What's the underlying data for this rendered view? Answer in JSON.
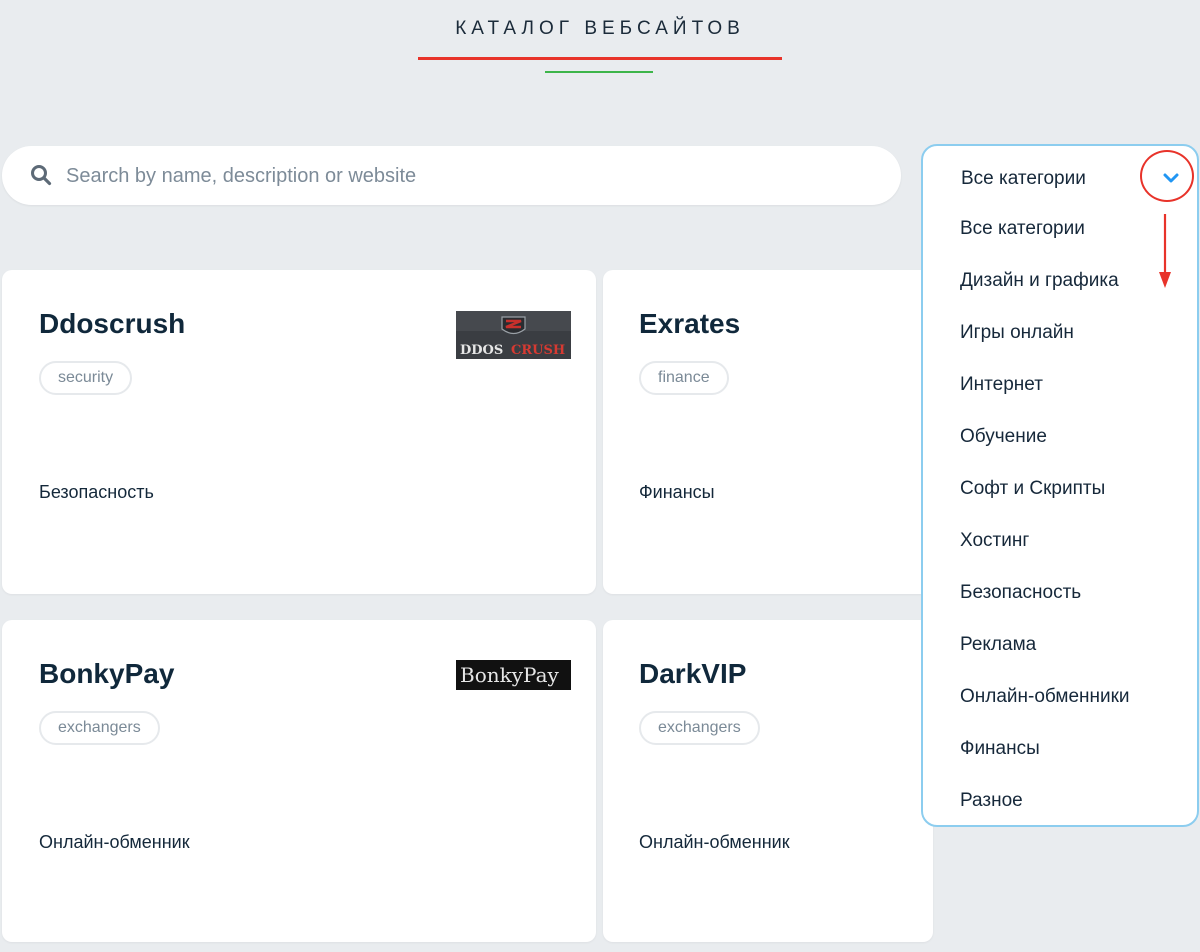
{
  "header": {
    "title": "КАТАЛОГ ВЕБСАЙТОВ"
  },
  "search": {
    "placeholder": "Search by name, description or website",
    "value": ""
  },
  "category_select": {
    "selected": "Все категории",
    "options": [
      "Все категории",
      "Дизайн и графика",
      "Игры онлайн",
      "Интернет",
      "Обучение",
      "Софт и Скрипты",
      "Хостинг",
      "Безопасность",
      "Реклама",
      "Онлайн-обменники",
      "Финансы",
      "Разное"
    ]
  },
  "cards": [
    {
      "title": "Ddoscrush",
      "tag": "security",
      "category": "Безопасность",
      "logo_text_a": "DDOS",
      "logo_text_b": "CRUSH"
    },
    {
      "title": "Exrates",
      "tag": "finance",
      "category": "Финансы"
    },
    {
      "title": "BonkyPay",
      "tag": "exchangers",
      "category": "Онлайн-обменник",
      "logo_text": "BonkyPay"
    },
    {
      "title": "DarkVIP",
      "tag": "exchangers",
      "category": "Онлайн-обменник"
    }
  ],
  "colors": {
    "background": "#e9ecef",
    "accent_red": "#e8332a",
    "accent_green": "#3db54a",
    "dropdown_border": "#8ccdef",
    "chevron_blue": "#2196f3",
    "title_text": "#10283b",
    "tag_text": "#7b8a97"
  },
  "icons": {
    "search": "search-icon",
    "dropdown": "chevron-down-icon"
  }
}
